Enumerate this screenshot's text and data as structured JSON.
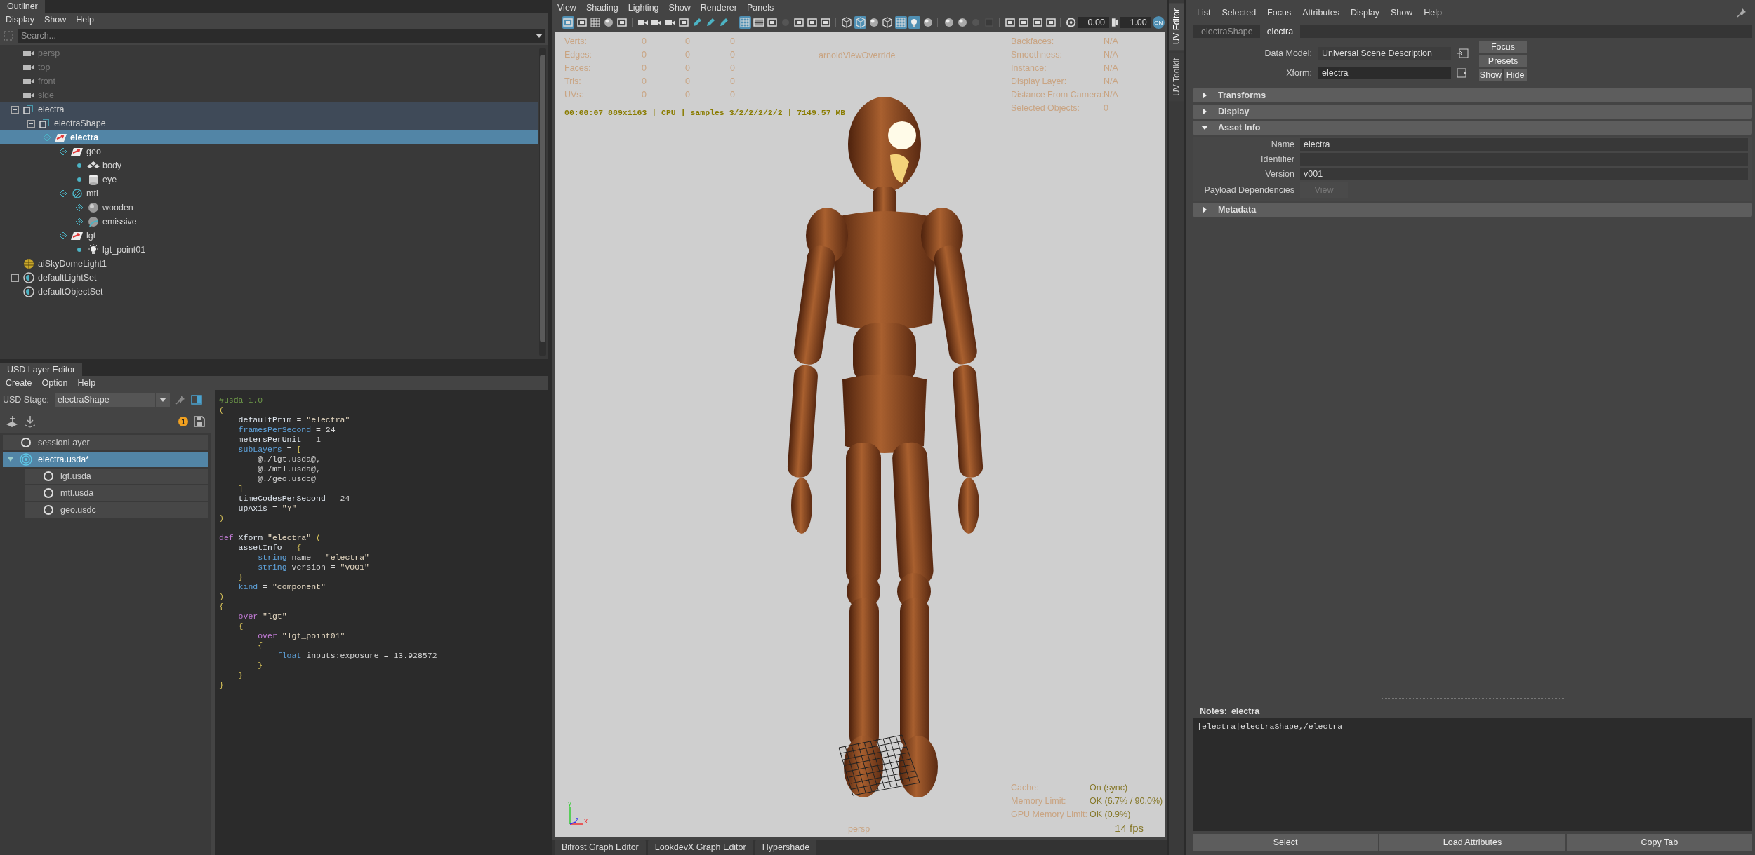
{
  "outliner": {
    "title": "Outliner",
    "menu": [
      "Display",
      "Show",
      "Help"
    ],
    "search": {
      "placeholder": "Search..."
    },
    "tree": [
      {
        "label": "persp",
        "kind": "camera",
        "dimmed": true,
        "highlighted": false,
        "selected": false
      },
      {
        "label": "top",
        "kind": "camera",
        "dimmed": true,
        "highlighted": false,
        "selected": false
      },
      {
        "label": "front",
        "kind": "camera",
        "dimmed": true,
        "highlighted": false,
        "selected": false
      },
      {
        "label": "side",
        "kind": "camera",
        "dimmed": true,
        "highlighted": false,
        "selected": false
      },
      {
        "label": "electra",
        "kind": "shape",
        "dimmed": false,
        "highlighted": true,
        "selected": false,
        "expanded": true,
        "children": [
          {
            "label": "electraShape",
            "kind": "shape",
            "dimmed": false,
            "highlighted": true,
            "selected": false,
            "expanded": true,
            "children": [
              {
                "label": "electra",
                "kind": "xform",
                "dimmed": false,
                "highlighted": false,
                "selected": true,
                "expanded": true,
                "children": [
                  {
                    "label": "geo",
                    "kind": "xform",
                    "dimmed": false,
                    "highlighted": false,
                    "selected": false,
                    "expanded": true,
                    "children": [
                      {
                        "label": "body",
                        "kind": "mesh",
                        "dimmed": false,
                        "highlighted": false,
                        "selected": false
                      },
                      {
                        "label": "eye",
                        "kind": "cylinder",
                        "dimmed": false,
                        "highlighted": false,
                        "selected": false
                      }
                    ]
                  },
                  {
                    "label": "mtl",
                    "kind": "scope",
                    "dimmed": false,
                    "highlighted": false,
                    "selected": false,
                    "expanded": true,
                    "children": [
                      {
                        "label": "wooden",
                        "kind": "sphere",
                        "dimmed": false,
                        "highlighted": false,
                        "selected": false,
                        "expanded": false
                      },
                      {
                        "label": "emissive",
                        "kind": "material",
                        "dimmed": false,
                        "highlighted": false,
                        "selected": false,
                        "expanded": false
                      }
                    ]
                  },
                  {
                    "label": "lgt",
                    "kind": "xform",
                    "dimmed": false,
                    "highlighted": false,
                    "selected": false,
                    "expanded": true,
                    "children": [
                      {
                        "label": "lgt_point01",
                        "kind": "bulb",
                        "dimmed": false,
                        "highlighted": false,
                        "selected": false
                      }
                    ]
                  }
                ]
              }
            ]
          }
        ]
      },
      {
        "label": "aiSkyDomeLight1",
        "kind": "dome",
        "dimmed": false,
        "highlighted": false,
        "selected": false
      },
      {
        "label": "defaultLightSet",
        "kind": "set",
        "dimmed": false,
        "highlighted": false,
        "selected": false,
        "expanded": false
      },
      {
        "label": "defaultObjectSet",
        "kind": "set",
        "dimmed": false,
        "highlighted": false,
        "selected": false
      }
    ]
  },
  "usd_layer_editor": {
    "title": "USD Layer Editor",
    "menu": [
      "Create",
      "Option",
      "Help"
    ],
    "stage_label": "USD Stage:",
    "stage": "electraShape",
    "dirty_count": "1",
    "layers": [
      {
        "label": "sessionLayer",
        "selected": false
      },
      {
        "label": "electra.usda*",
        "selected": true,
        "expanded": true,
        "children": [
          {
            "label": "lgt.usda",
            "selected": false
          },
          {
            "label": "mtl.usda",
            "selected": false
          },
          {
            "label": "geo.usdc",
            "selected": false
          }
        ]
      }
    ],
    "code": [
      {
        "tokens": [
          {
            "kind": "comment",
            "text": "#usda 1.0"
          }
        ]
      },
      {
        "tokens": [
          {
            "kind": "punct",
            "text": "("
          }
        ]
      },
      {
        "tokens": [
          {
            "kind": "name",
            "text": "    defaultPrim"
          },
          {
            "kind": "plain",
            "text": " = "
          },
          {
            "kind": "string",
            "text": "\"electra\""
          }
        ]
      },
      {
        "tokens": [
          {
            "kind": "type",
            "text": "    framesPerSecond"
          },
          {
            "kind": "plain",
            "text": " = 24"
          }
        ]
      },
      {
        "tokens": [
          {
            "kind": "name",
            "text": "    metersPerUnit"
          },
          {
            "kind": "plain",
            "text": " = 1"
          }
        ]
      },
      {
        "tokens": [
          {
            "kind": "type",
            "text": "    subLayers"
          },
          {
            "kind": "plain",
            "text": " = "
          },
          {
            "kind": "punct",
            "text": "["
          }
        ]
      },
      {
        "tokens": [
          {
            "kind": "plain",
            "text": "        @./lgt.usda@,"
          }
        ]
      },
      {
        "tokens": [
          {
            "kind": "plain",
            "text": "        @./mtl.usda@,"
          }
        ]
      },
      {
        "tokens": [
          {
            "kind": "plain",
            "text": "        @./geo.usdc@"
          }
        ]
      },
      {
        "tokens": [
          {
            "kind": "punct",
            "text": "    ]"
          }
        ]
      },
      {
        "tokens": [
          {
            "kind": "name",
            "text": "    timeCodesPerSecond"
          },
          {
            "kind": "plain",
            "text": " = 24"
          }
        ]
      },
      {
        "tokens": [
          {
            "kind": "name",
            "text": "    upAxis"
          },
          {
            "kind": "plain",
            "text": " = "
          },
          {
            "kind": "string",
            "text": "\"Y\""
          }
        ]
      },
      {
        "tokens": [
          {
            "kind": "punct",
            "text": ")"
          }
        ]
      },
      {
        "blank_before": true,
        "tokens": [
          {
            "kind": "keyword",
            "text": "def"
          },
          {
            "kind": "name",
            "text": " Xform"
          },
          {
            "kind": "string",
            "text": " \"electra\""
          },
          {
            "kind": "punct",
            "text": " ("
          }
        ]
      },
      {
        "tokens": [
          {
            "kind": "name",
            "text": "    assetInfo"
          },
          {
            "kind": "plain",
            "text": " = "
          },
          {
            "kind": "punct",
            "text": "{"
          }
        ]
      },
      {
        "tokens": [
          {
            "kind": "type",
            "text": "        string"
          },
          {
            "kind": "plain",
            "text": " name = "
          },
          {
            "kind": "string",
            "text": "\"electra\""
          }
        ]
      },
      {
        "tokens": [
          {
            "kind": "type",
            "text": "        string"
          },
          {
            "kind": "plain",
            "text": " version = "
          },
          {
            "kind": "string",
            "text": "\"v001\""
          }
        ]
      },
      {
        "tokens": [
          {
            "kind": "punct",
            "text": "    }"
          }
        ]
      },
      {
        "tokens": [
          {
            "kind": "type",
            "text": "    kind"
          },
          {
            "kind": "plain",
            "text": " = "
          },
          {
            "kind": "string",
            "text": "\"component\""
          }
        ]
      },
      {
        "tokens": [
          {
            "kind": "punct",
            "text": ")"
          }
        ]
      },
      {
        "tokens": [
          {
            "kind": "punct",
            "text": "{"
          }
        ]
      },
      {
        "tokens": [
          {
            "kind": "keyword",
            "text": "    over"
          },
          {
            "kind": "string",
            "text": " \"lgt\""
          }
        ]
      },
      {
        "tokens": [
          {
            "kind": "punct",
            "text": "    {"
          }
        ]
      },
      {
        "tokens": [
          {
            "kind": "keyword",
            "text": "        over"
          },
          {
            "kind": "string",
            "text": " \"lgt_point01\""
          }
        ]
      },
      {
        "tokens": [
          {
            "kind": "punct",
            "text": "        {"
          }
        ]
      },
      {
        "tokens": [
          {
            "kind": "type",
            "text": "            float"
          },
          {
            "kind": "plain",
            "text": " inputs:exposure = 13.928572"
          }
        ]
      },
      {
        "tokens": [
          {
            "kind": "punct",
            "text": "        }"
          }
        ]
      },
      {
        "tokens": [
          {
            "kind": "punct",
            "text": "    }"
          }
        ]
      },
      {
        "tokens": [
          {
            "kind": "punct",
            "text": "}"
          }
        ]
      }
    ]
  },
  "viewport": {
    "menu": [
      "View",
      "Shading",
      "Lighting",
      "Show",
      "Renderer",
      "Panels"
    ],
    "toolbar": [
      [
        {
          "on": true
        },
        {
          "on": false
        },
        {
          "on": false
        },
        {
          "on": false
        },
        {
          "on": false
        }
      ],
      [
        {
          "on": false
        },
        {
          "on": false
        },
        {
          "on": false
        },
        {
          "on": false
        },
        {
          "on": false
        },
        {
          "on": false
        },
        {
          "on": false
        }
      ],
      [
        {
          "on": true
        },
        {
          "on": false
        },
        {
          "on": false
        },
        {
          "on": false
        },
        {
          "on": false
        },
        {
          "on": false
        },
        {
          "on": false
        }
      ],
      [
        {
          "on": false
        },
        {
          "on": true
        },
        {
          "on": false
        },
        {
          "on": false
        },
        {
          "on": true
        },
        {
          "on": true
        },
        {
          "on": false
        }
      ],
      [
        {
          "on": false
        },
        {
          "on": false
        },
        {
          "on": false
        },
        {
          "on": false
        }
      ],
      [
        {
          "on": false
        },
        {
          "on": false
        },
        {
          "on": false
        },
        {
          "on": false
        }
      ]
    ],
    "exposure": "0.00",
    "gamma": "1.00",
    "toggle": {
      "label": "ON",
      "on": true
    },
    "stats": [
      {
        "label": "Verts:",
        "values": [
          "0",
          "0",
          "0"
        ]
      },
      {
        "label": "Edges:",
        "values": [
          "0",
          "0",
          "0"
        ]
      },
      {
        "label": "Faces:",
        "values": [
          "0",
          "0",
          "0"
        ]
      },
      {
        "label": "Tris:",
        "values": [
          "0",
          "0",
          "0"
        ]
      },
      {
        "label": "UVs:",
        "values": [
          "0",
          "0",
          "0"
        ]
      }
    ],
    "override": "arnoldViewOverride",
    "info": [
      {
        "label": "Backfaces:",
        "value": "N/A"
      },
      {
        "label": "Smoothness:",
        "value": "N/A"
      },
      {
        "label": "Instance:",
        "value": "N/A"
      },
      {
        "label": "Display Layer:",
        "value": "N/A"
      },
      {
        "label": "Distance From Camera:",
        "value": "N/A"
      },
      {
        "label": "Selected Objects:",
        "value": "0"
      }
    ],
    "render_status": "00:00:07 889x1163 | CPU | samples 3/2/2/2/2/2 | 7149.57 MB",
    "memory": [
      {
        "label": "Cache:",
        "value": "On (sync)"
      },
      {
        "label": "Memory Limit:",
        "value": "OK (6.7% / 90.0%)"
      },
      {
        "label": "GPU Memory Limit:",
        "value": "OK (0.9%)"
      }
    ],
    "fps": "14 fps",
    "camera": "persp",
    "axis_labels": [
      "y",
      "x",
      "z"
    ],
    "bottom_tabs": [
      {
        "label": "Bifrost Graph Editor",
        "selected": false
      },
      {
        "label": "LookdevX Graph Editor",
        "selected": false
      },
      {
        "label": "Hypershade",
        "selected": false
      }
    ]
  },
  "side_tabs": [
    {
      "label": "UV Editor",
      "selected": true
    },
    {
      "label": "UV Toolkit",
      "selected": false
    }
  ],
  "attribute_editor": {
    "menu": [
      "List",
      "Selected",
      "Focus",
      "Attributes",
      "Display",
      "Show",
      "Help"
    ],
    "tabs": [
      {
        "label": "electraShape",
        "selected": false
      },
      {
        "label": "electra",
        "selected": true
      }
    ],
    "data_model": {
      "label": "Data Model:",
      "value": "Universal Scene Description"
    },
    "xform": {
      "label": "Xform:",
      "value": "electra"
    },
    "buttons": [
      "Focus",
      "Presets",
      "Show",
      "Hide"
    ],
    "sections": [
      {
        "title": "Transforms",
        "expanded": false
      },
      {
        "title": "Display",
        "expanded": false
      },
      {
        "title": "Asset Info",
        "expanded": true,
        "fields": [
          {
            "label": "Name",
            "value": "electra"
          },
          {
            "label": "Identifier"
          },
          {
            "label": "Version",
            "value": "v001"
          }
        ],
        "payload": {
          "label": "Payload Dependencies",
          "button": "View",
          "disabled": true
        }
      },
      {
        "title": "Metadata",
        "expanded": false
      }
    ],
    "notes": {
      "label": "Notes:",
      "target": "electra",
      "text": "|electra|electraShape,/electra"
    },
    "bottom_buttons": [
      "Select",
      "Load Attributes",
      "Copy Tab"
    ]
  }
}
